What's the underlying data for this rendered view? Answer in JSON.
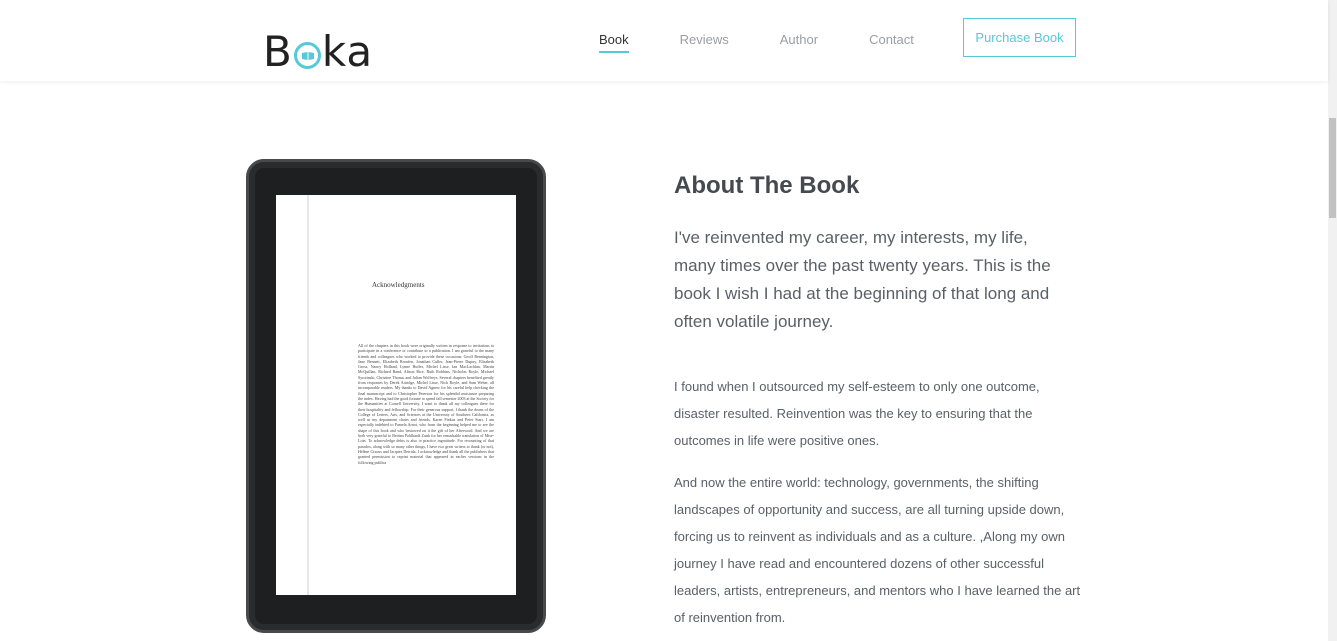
{
  "brand": {
    "logo_prefix": "B",
    "logo_suffix": "ka",
    "accent": "#56c9d6"
  },
  "nav": {
    "items": [
      {
        "label": "Book",
        "active": true
      },
      {
        "label": "Reviews",
        "active": false
      },
      {
        "label": "Author",
        "active": false
      },
      {
        "label": "Contact",
        "active": false
      }
    ],
    "cta_label": "Purchase Book"
  },
  "tablet": {
    "page_title": "Acknowledgments",
    "page_text": "All of the chapters in this book were originally written in response to invitations to participate in a conference or contribute to a publication. I am grateful to the many friends and colleagues who worked to provide these occasions: Geoff Bennington, Jane Bennett, Elizabeth Bronfen, Jonathan Culler, Jean-Pierre Dupuy, Elisabeth Gross, Nancy Holland, Lynne Huffer, Michel Lisse, Ian MacLachlan, Martin McQuillan, Richard Rand, Alison Rice, Ruth Robbins, Nicholas Royle, Michael Syrotinski, Christine Thoma, and Julian Wolfreys. Several chapters benefited greatly from responses by Derek Attridge, Michel Lisse, Nick Royle, and Sam Weber, all incomparable readers. My thanks to David Agnew for his careful help checking the final manuscript and to Christopher Peterson for his splendid assistance preparing the index. Having had the good fortune to spend fall semester 2003 at the Society for the Humanities at Cornell University, I want to thank all my colleagues there for their hospitality and fellowship. For their generous support, I thank the deans of the College of Letters, Arts, and Sciences at the University of Southern California, as well as my department chairs and friends, Karen Pinkus and Peter Starr. I am especially indebted to Pamela Arnot, who from the beginning helped me to see the shape of this book and who bestowed on it the gift of her Afterword. And we are both very grateful to Bettina Pohlhardt Zunk for her remarkable translation of Mise-Loin. To acknowledge debts is also to practice ingratitude. For recounting of that paradox, along with so many other things, I have two great writers to thank (or not), Hélène Cixous and Jacques Derrida. I acknowledge and thank all the publishers that granted permission to reprint material that appeared in earlier versions in the following publica"
  },
  "about": {
    "title": "About The Book",
    "lead": "I've reinvented my career, my interests, my life, many times over the past twenty years. This is the book I wish I had at the beginning of that long and often volatile journey.",
    "paragraph_1": "I found when I outsourced my self-esteem to only one outcome, disaster resulted. Reinvention was the key to ensuring that the outcomes in life were positive ones.",
    "paragraph_2": "And now the entire world: technology, governments, the shifting landscapes of opportunity and success, are all turning upside down, forcing us to reinvent as individuals and as a culture. ,Along my own journey I have read and encountered dozens of other successful leaders, artists, entrepreneurs, and mentors who I have learned the art of reinvention from."
  }
}
